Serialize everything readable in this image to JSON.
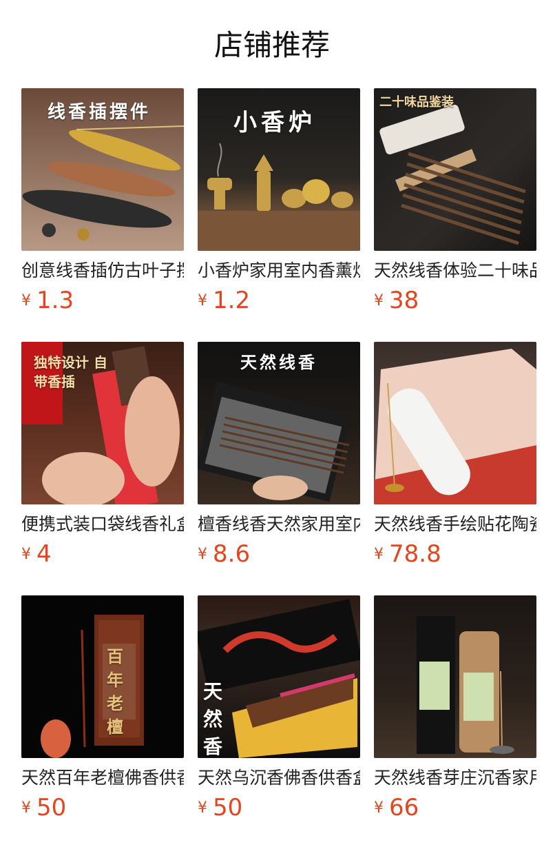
{
  "section": {
    "title": "店铺推荐"
  },
  "currency_symbol": "¥",
  "products": [
    {
      "name": "创意线香插仿古叶子摆件",
      "price": "1.3",
      "image_text": "线香插摆件",
      "image_desc": "leaf-shaped incense holders"
    },
    {
      "name": "小香炉家用室内香薰炉",
      "price": "1.2",
      "image_text": "小香炉",
      "image_desc": "small incense burners"
    },
    {
      "name": "天然线香体验二十味品鉴装",
      "price": "38",
      "image_text": "二十味品鉴装",
      "image_desc": "incense tube set"
    },
    {
      "name": "便携式装口袋线香礼盒",
      "price": "4",
      "image_text": "独特设计 自带香插",
      "image_desc": "pocket incense box"
    },
    {
      "name": "檀香线香天然家用室内",
      "price": "8.6",
      "image_text": "天然线香",
      "image_desc": "sandalwood incense box"
    },
    {
      "name": "天然线香手绘贴花陶瓷筒",
      "price": "78.8",
      "image_text": "",
      "image_desc": "incense ceramic tube gift box"
    },
    {
      "name": "天然百年老檀佛香供香",
      "price": "50",
      "image_text": "百年老檀",
      "image_desc": "old sandalwood incense box"
    },
    {
      "name": "天然乌沉香佛香供香盒装",
      "price": "50",
      "image_text": "天然香",
      "image_desc": "agarwood incense box"
    },
    {
      "name": "天然线香芽庄沉香家用",
      "price": "66",
      "image_text": "",
      "image_desc": "nha trang agarwood incense tubes"
    }
  ]
}
